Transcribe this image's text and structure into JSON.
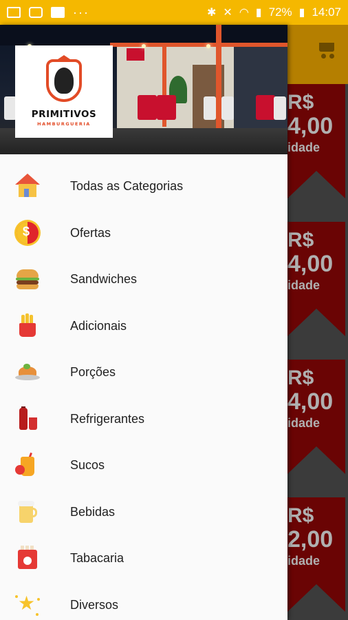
{
  "status_bar": {
    "notification_icons": [
      "gallery-icon",
      "food-app-icon",
      "flipboard-icon"
    ],
    "more": "···",
    "battery": "72%",
    "time": "14:07"
  },
  "background_app": {
    "promos": [
      {
        "currency": "R$",
        "value": "4,00",
        "unit": "idade"
      },
      {
        "currency": "R$",
        "value": "4,00",
        "unit": "idade"
      },
      {
        "currency": "R$",
        "value": "4,00",
        "unit": "idade"
      },
      {
        "currency": "R$",
        "value": "2,00",
        "unit": "idade"
      }
    ],
    "colors": {
      "toolbar": "#b57f00",
      "promo": "#6a0404",
      "text": "#b0b0b0"
    }
  },
  "drawer": {
    "logo": {
      "name": "PRIMITIVOS",
      "subtitle": "HAMBURGUERIA"
    },
    "menu": [
      {
        "label": "Todas as Categorias",
        "icon": "house-icon"
      },
      {
        "label": "Ofertas",
        "icon": "offer-icon"
      },
      {
        "label": "Sandwiches",
        "icon": "burger-icon"
      },
      {
        "label": "Adicionais",
        "icon": "fries-icon"
      },
      {
        "label": "Porções",
        "icon": "portion-icon"
      },
      {
        "label": "Refrigerantes",
        "icon": "soda-icon"
      },
      {
        "label": "Sucos",
        "icon": "juice-icon"
      },
      {
        "label": "Bebidas",
        "icon": "beer-icon"
      },
      {
        "label": "Tabacaria",
        "icon": "tobacco-icon"
      },
      {
        "label": "Diversos",
        "icon": "star-icon"
      }
    ]
  },
  "colors": {
    "status_bar": "#f5b800",
    "drawer_bg": "#fafafa",
    "brand_accent": "#e24b26"
  }
}
